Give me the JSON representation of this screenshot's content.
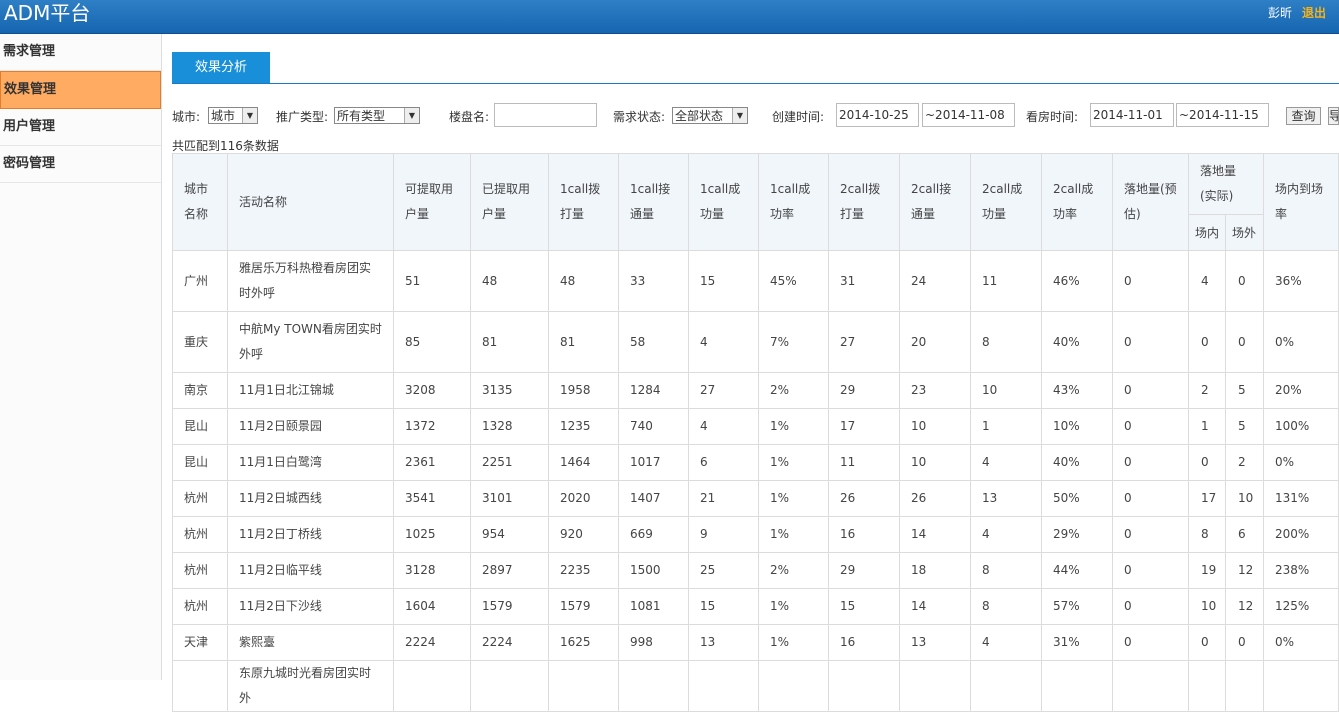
{
  "header": {
    "logo": "ADM平台",
    "user": "彭昕",
    "logout": "退出"
  },
  "sidebar": {
    "items": [
      {
        "label": "需求管理"
      },
      {
        "label": "效果管理",
        "active": true
      },
      {
        "label": "用户管理"
      },
      {
        "label": "密码管理"
      }
    ]
  },
  "tab": {
    "label": "效果分析"
  },
  "filters": {
    "city_label": "城市:",
    "city_value": "城市",
    "type_label": "推广类型:",
    "type_value": "所有类型",
    "building_label": "楼盘名:",
    "building_value": "",
    "status_label": "需求状态:",
    "status_value": "全部状态",
    "create_label": "创建时间:",
    "create_start": "2014-10-25",
    "create_end": "~2014-11-08",
    "visit_label": "看房时间:",
    "visit_start": "2014-11-01",
    "visit_end": "~2014-11-15",
    "query_button": "查询",
    "export_button": "导"
  },
  "result_count": "共匹配到116条数据",
  "table": {
    "headers": {
      "city": "城市名称",
      "activity": "活动名称",
      "available": "可提取用户量",
      "extracted": "已提取用户量",
      "c1_dial": "1call拨打量",
      "c1_connect": "1call接通量",
      "c1_success": "1call成功量",
      "c1_rate": "1call成功率",
      "c2_dial": "2call拨打量",
      "c2_connect": "2call接通量",
      "c2_success": "2call成功量",
      "c2_rate": "2call成功率",
      "landed_est": "落地量(预估)",
      "landed_actual": "落地量(实际)",
      "inside": "场内",
      "outside": "场外",
      "arrival_rate": "场内到场率"
    },
    "rows": [
      [
        "广州",
        "雅居乐万科热橙看房团实时外呼",
        "51",
        "48",
        "48",
        "33",
        "15",
        "45%",
        "31",
        "24",
        "11",
        "46%",
        "0",
        "4",
        "0",
        "36%"
      ],
      [
        "重庆",
        "中航My TOWN看房团实时外呼",
        "85",
        "81",
        "81",
        "58",
        "4",
        "7%",
        "27",
        "20",
        "8",
        "40%",
        "0",
        "0",
        "0",
        "0%"
      ],
      [
        "南京",
        "11月1日北江锦城",
        "3208",
        "3135",
        "1958",
        "1284",
        "27",
        "2%",
        "29",
        "23",
        "10",
        "43%",
        "0",
        "2",
        "5",
        "20%"
      ],
      [
        "昆山",
        "11月2日颐景园",
        "1372",
        "1328",
        "1235",
        "740",
        "4",
        "1%",
        "17",
        "10",
        "1",
        "10%",
        "0",
        "1",
        "5",
        "100%"
      ],
      [
        "昆山",
        "11月1日白鹭湾",
        "2361",
        "2251",
        "1464",
        "1017",
        "6",
        "1%",
        "11",
        "10",
        "4",
        "40%",
        "0",
        "0",
        "2",
        "0%"
      ],
      [
        "杭州",
        "11月2日城西线",
        "3541",
        "3101",
        "2020",
        "1407",
        "21",
        "1%",
        "26",
        "26",
        "13",
        "50%",
        "0",
        "17",
        "10",
        "131%"
      ],
      [
        "杭州",
        "11月2日丁桥线",
        "1025",
        "954",
        "920",
        "669",
        "9",
        "1%",
        "16",
        "14",
        "4",
        "29%",
        "0",
        "8",
        "6",
        "200%"
      ],
      [
        "杭州",
        "11月2日临平线",
        "3128",
        "2897",
        "2235",
        "1500",
        "25",
        "2%",
        "29",
        "18",
        "8",
        "44%",
        "0",
        "19",
        "12",
        "238%"
      ],
      [
        "杭州",
        "11月2日下沙线",
        "1604",
        "1579",
        "1579",
        "1081",
        "15",
        "1%",
        "15",
        "14",
        "8",
        "57%",
        "0",
        "10",
        "12",
        "125%"
      ],
      [
        "天津",
        "紫熙臺",
        "2224",
        "2224",
        "1625",
        "998",
        "13",
        "1%",
        "16",
        "13",
        "4",
        "31%",
        "0",
        "0",
        "0",
        "0%"
      ],
      [
        "",
        "东原九城时光看房团实时外",
        "",
        "",
        "",
        "",
        "",
        "",
        "",
        "",
        "",
        "",
        "",
        "",
        "",
        ""
      ]
    ]
  }
}
